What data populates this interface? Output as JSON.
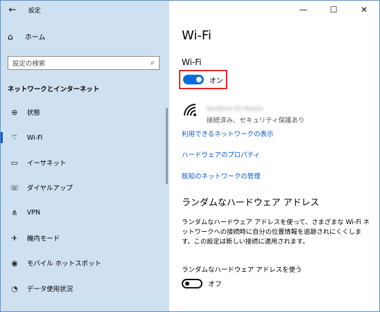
{
  "window": {
    "title": "設定",
    "back_icon": "←",
    "minimize": "—",
    "maximize": "☐",
    "close": "✕"
  },
  "sidebar": {
    "home_label": "ホーム",
    "home_icon": "⌂",
    "search_placeholder": "設定の検索",
    "search_icon": "⌕",
    "section_title": "ネットワークとインターネット",
    "items": [
      {
        "label": "状態",
        "icon": "⊕"
      },
      {
        "label": "Wi-Fi",
        "icon": "⌔"
      },
      {
        "label": "イーサネット",
        "icon": "▭"
      },
      {
        "label": "ダイヤルアップ",
        "icon": "☏"
      },
      {
        "label": "VPN",
        "icon": "⋔"
      },
      {
        "label": "機内モード",
        "icon": "✈"
      },
      {
        "label": "モバイル ホットスポット",
        "icon": "◉"
      },
      {
        "label": "データ使用状況",
        "icon": "◔"
      }
    ]
  },
  "main": {
    "page_title": "Wi-Fi",
    "wifi_heading": "Wi-Fi",
    "wifi_toggle_label": "オン",
    "network_status": "接続済み、セキュリティ保護あり",
    "network_name": "NetWork-5G-Mobile",
    "links": {
      "show_available": "利用できるネットワークの表示",
      "hardware_props": "ハードウェアのプロパティ",
      "manage_known": "既知のネットワークの管理"
    },
    "random_heading": "ランダムなハードウェア アドレス",
    "random_desc": "ランダムなハードウェア アドレスを使って、さまざまな Wi-Fi ネットワークへの接続時に自分の位置情報を追跡されにくくします。この設定は新しい接続に適用されます。",
    "random_toggle_label_text": "ランダムなハードウェア アドレスを使う",
    "random_toggle_state": "オフ"
  },
  "colors": {
    "sidebar_bg": "#cfe0f1",
    "accent": "#0a58ca",
    "toggle_on": "#0a6cd6",
    "highlight_border": "#e0262a"
  }
}
